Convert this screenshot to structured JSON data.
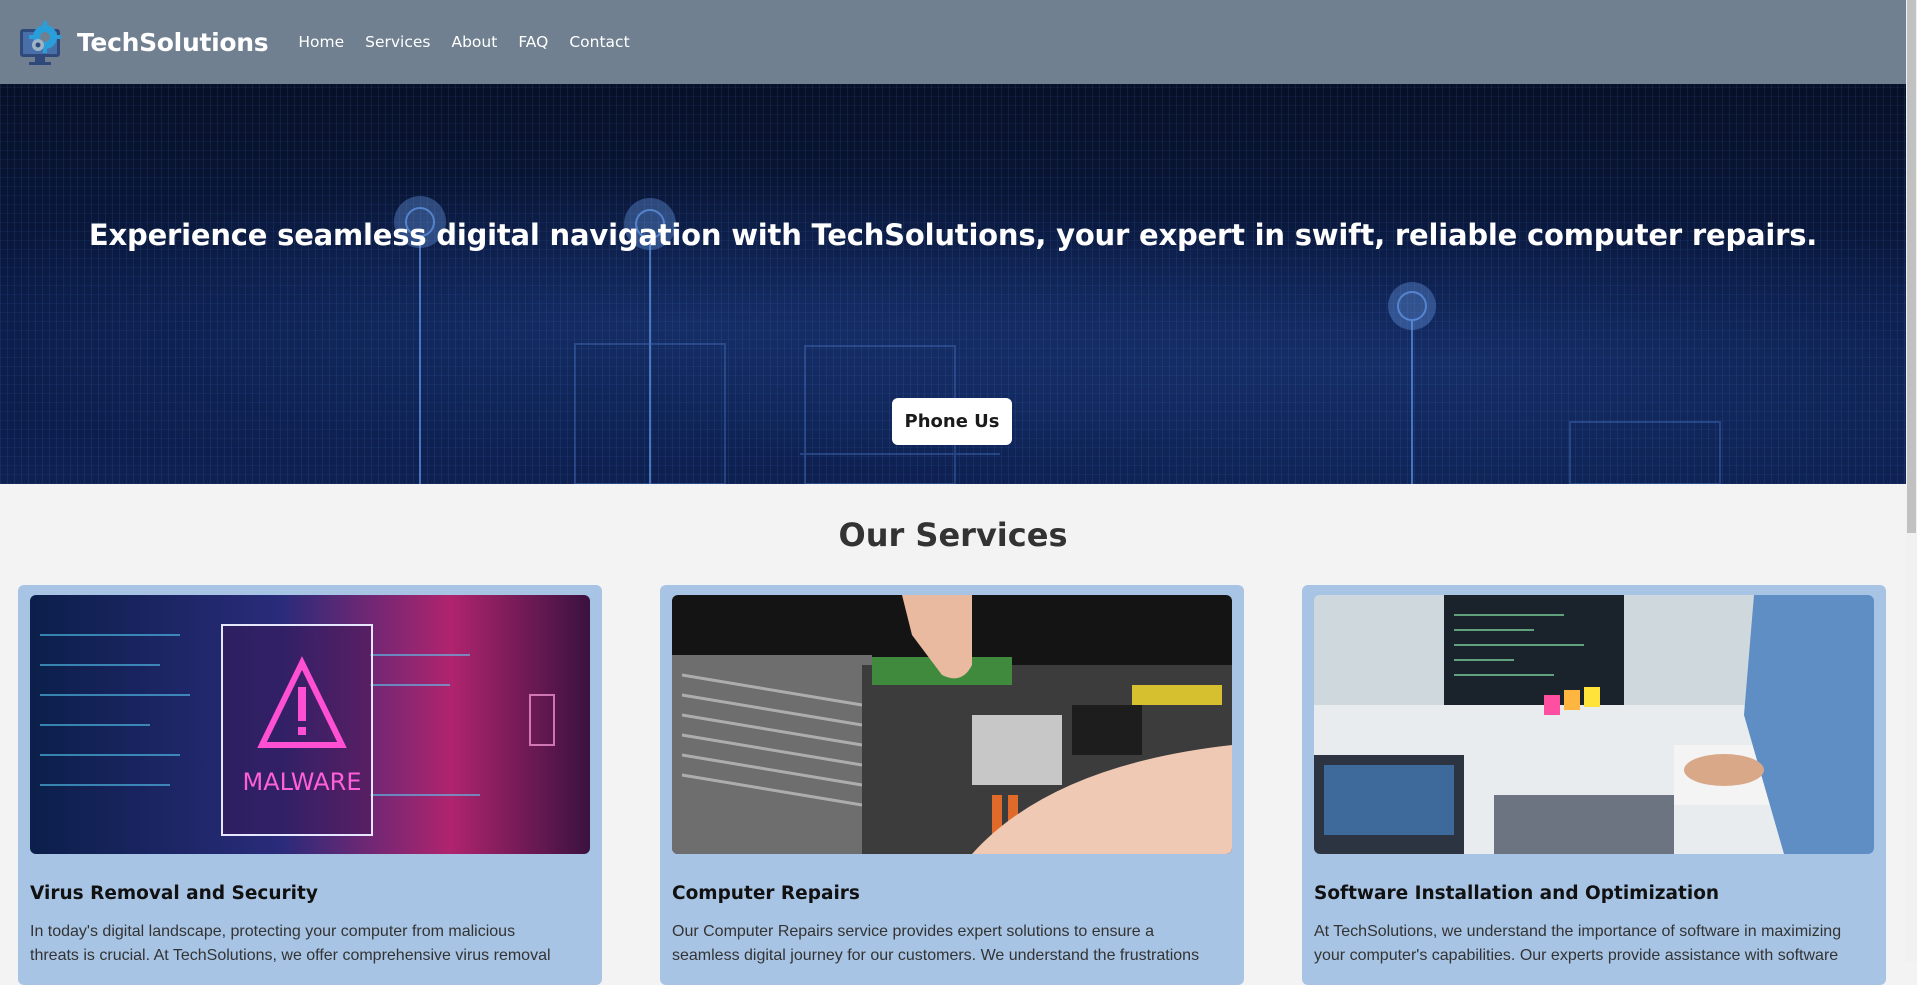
{
  "header": {
    "brand": "TechSolutions",
    "logo_icon": "gear-monitor-icon",
    "nav": [
      "Home",
      "Services",
      "About",
      "FAQ",
      "Contact"
    ],
    "background": "#708090"
  },
  "hero": {
    "headline": "Experience seamless digital navigation with TechSolutions, your expert in swift, reliable computer repairs.",
    "cta_label": "Phone Us"
  },
  "services": {
    "heading": "Our Services",
    "cards": [
      {
        "title": "Virus Removal and Security",
        "image_text": "MALWARE",
        "text_line1": "In today's digital landscape, protecting your computer from malicious",
        "text_line2": "threats is crucial. At TechSolutions, we offer comprehensive virus removal"
      },
      {
        "title": "Computer Repairs",
        "text_line1": "Our Computer Repairs service provides expert solutions to ensure a",
        "text_line2": "seamless digital journey for our customers. We understand the frustrations"
      },
      {
        "title": "Software Installation and Optimization",
        "text_line1": "At TechSolutions, we understand the importance of software in maximizing",
        "text_line2": "your computer's capabilities. Our experts provide assistance with software"
      }
    ],
    "card_color": "#a8c4e4"
  }
}
